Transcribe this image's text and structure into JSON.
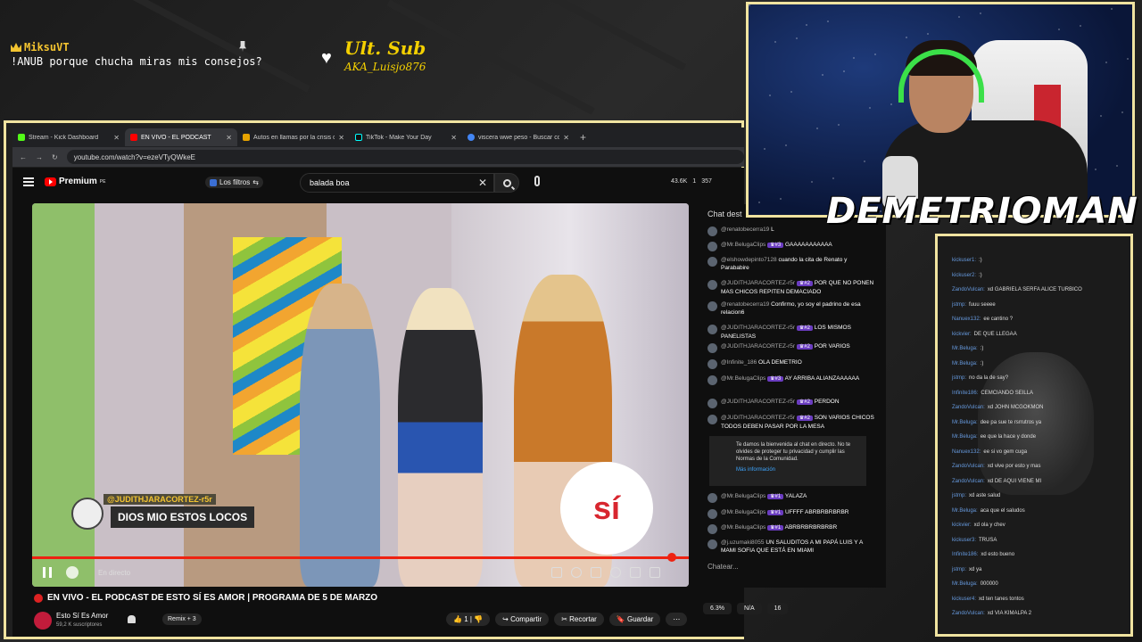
{
  "top_chat": {
    "user": "MiksuVT",
    "message": "!ANUB porque chucha miras mis consejos?"
  },
  "last_sub": {
    "title": "Ult. Sub",
    "name": "AKA_Luisjo876"
  },
  "browser": {
    "tabs": [
      {
        "label": "Stream - Kick Dashboard",
        "color": "#53fc18"
      },
      {
        "label": "EN VIVO - EL PODCAST",
        "color": "#ff0000",
        "active": true
      },
      {
        "label": "Autos en llamas por la crisis de",
        "color": "#e6a300"
      },
      {
        "label": "TikTok - Make Your Day",
        "color": "#111111"
      },
      {
        "label": "viscera wwe peso - Buscar con",
        "color": "#4285f4"
      }
    ],
    "url": "youtube.com/watch?v=ezeVTyQWkeE"
  },
  "youtube": {
    "logo": "Premium",
    "logo_sup": "PE",
    "filters": "Los filtros",
    "search_value": "balada boa",
    "stats": [
      "43.6K",
      "1",
      "357"
    ],
    "comment_overlay": {
      "user": "@JUDITHJARACORTEZ-r5r",
      "text": "DIOS MIO ESTOS LOCOS"
    },
    "brand_badge": "sí",
    "live_label": "En directo",
    "title": "EN VIVO - EL PODCAST DE ESTO SÍ ES AMOR | PROGRAMA DE 5 DE MARZO",
    "channel": "Esto Sí Es Amor",
    "subscribers": "59,2 K suscriptores",
    "remix": "Remix + 3",
    "actions": [
      "1",
      "",
      "Compartir",
      "Recortar",
      "Guardar"
    ],
    "chat_header": "Chat dest",
    "chat": [
      {
        "user": "@renatobecerra19",
        "text": "L"
      },
      {
        "user": "@Mr.BelugaClips",
        "badge": "#3",
        "text": "GAAAAAAAAAAA"
      },
      {
        "user": "@elshowdepinto7128",
        "text": "cuando la cita de Renato y Parababire"
      },
      {
        "user": "@JUDITHJARACORTEZ-r5r",
        "badge": "#2",
        "text": "POR QUE NO PONEN MAS CHICOS REPITEN DEMACIADO"
      },
      {
        "user": "@renatobecerra19",
        "text": "Confirmo, yo soy el padrino de esa relacion6"
      },
      {
        "user": "@JUDITHJARACORTEZ-r5r",
        "badge": "#2",
        "text": "LOS MISMOS PANELISTAS"
      },
      {
        "user": "@JUDITHJARACORTEZ-r5r",
        "badge": "#2",
        "text": "POR VARIOS"
      },
      {
        "user": "@Infinite_186",
        "text": "OLA DEMETRIO"
      },
      {
        "user": "@Mr.BelugaClips",
        "badge": "#3",
        "text": "AY ARRIBA ALIANZAAAAAA"
      },
      {
        "user": "@JUDITHJARACORTEZ-r5r",
        "badge": "#2",
        "text": "PERDON"
      },
      {
        "user": "@JUDITHJARACORTEZ-r5r",
        "badge": "#2",
        "text": "SON VARIOS CHICOS TODOS DEBEN PASAR POR LA MESA"
      }
    ],
    "notice": "Te damos la bienvenida al chat en directo. No te olvides de proteger tu privacidad y cumplir las Normas de la Comunidad.",
    "notice_link": "Más información",
    "chat_after": [
      {
        "user": "@Mr.BelugaClips",
        "badge": "#1",
        "text": "YALAZA"
      },
      {
        "user": "@Mr.BelugaClips",
        "badge": "#1",
        "text": "UFFFF ABRBRBRBRBR"
      },
      {
        "user": "@Mr.BelugaClips",
        "badge": "#1",
        "text": "ABRBRBRBRBRBR"
      },
      {
        "user": "@j.uzumaki8055",
        "text": "UN SALUDITOS A MI PAPÁ LUIS Y A MAMI SOFIA QUE ESTÁ EN MIAMI"
      }
    ],
    "chat_placeholder": "Chatear...",
    "bottom_pills": [
      "6.3%",
      "N/A",
      "16"
    ]
  },
  "streamer_name": "DEMETRIOMAN",
  "right_chat": [
    {
      "name": "kickuser1",
      "text": ":)"
    },
    {
      "name": "kickuser2",
      "text": ":)"
    },
    {
      "name": "ZandoVulcan",
      "text": "xd GABRIELA SERFA ALICE TURBICO"
    },
    {
      "name": "jstmp",
      "text": "fuuu seeee"
    },
    {
      "name": "Nanuex132",
      "text": "ee cantino ?"
    },
    {
      "name": "kickvier",
      "text": "DE QUE LLEGAA"
    },
    {
      "name": "Mr.Beluga",
      "text": ":)"
    },
    {
      "name": "Mr.Beluga",
      "text": ":)"
    },
    {
      "name": "jstmp",
      "text": "no da la de say?"
    },
    {
      "name": "Infinite186",
      "text": "CEMCIANDO SEILLA"
    },
    {
      "name": "ZandoVulcan",
      "text": "xd JOHN MCGOKMON"
    },
    {
      "name": "Mr.Beluga",
      "text": "dee pa sue te rsrrutros ya"
    },
    {
      "name": "Mr.Beluga",
      "text": "ee que la hace y donde"
    },
    {
      "name": "Nanuex132",
      "text": "ee si vo gem cuga"
    },
    {
      "name": "ZandoVulcan",
      "text": "xd vive por esto y mas"
    },
    {
      "name": "ZandoVulcan",
      "text": "xd DE AQUI VIENE MI"
    },
    {
      "name": "jstmp",
      "text": "xd aste salud"
    },
    {
      "name": "Mr.Beluga",
      "text": "aca que el saludos"
    },
    {
      "name": "kickvier",
      "text": "xd ola y chev"
    },
    {
      "name": "kickuser3",
      "text": "TRUSA"
    },
    {
      "name": "Infinite186",
      "text": "xd esto bueno"
    },
    {
      "name": "jstmp",
      "text": "xd ya"
    },
    {
      "name": "Mr.Beluga",
      "text": "000000"
    },
    {
      "name": "kickuser4",
      "text": "xd ten tanes tontos"
    },
    {
      "name": "ZandoVulcan",
      "text": "xd VIA KIMALPA 2"
    }
  ],
  "colors": {
    "frame": "#f0e3a0",
    "accent_yellow": "#f4c430",
    "yt_red": "#ff0000",
    "badge_purple": "#6a3cc0"
  }
}
